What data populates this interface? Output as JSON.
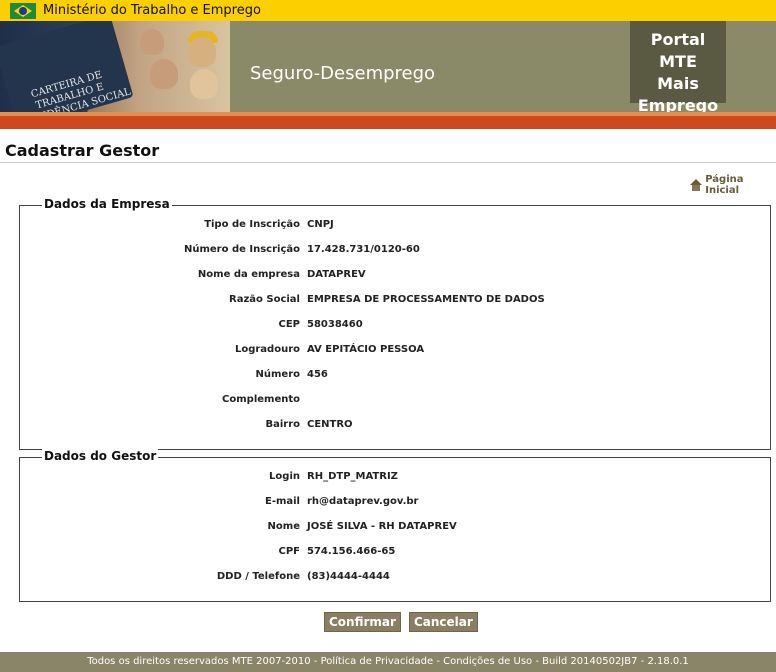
{
  "gov_bar": {
    "title": "Ministério do Trabalho e Emprego"
  },
  "banner": {
    "card_text": "CARTEIRA DE TRABALHO E PREVIDÊNCIA SOCIAL",
    "title": "Seguro-Desemprego",
    "portal_lines": [
      "Portal MTE",
      "Mais",
      "Emprego"
    ]
  },
  "page": {
    "title": "Cadastrar Gestor",
    "home_link": "Página Inicial"
  },
  "empresa": {
    "legend": "Dados da Empresa",
    "rows": [
      {
        "label": "Tipo de Inscrição",
        "value": "CNPJ"
      },
      {
        "label": "Número de Inscrição",
        "value": "17.428.731/0120-60"
      },
      {
        "label": "Nome da empresa",
        "value": "DATAPREV"
      },
      {
        "label": "Razão Social",
        "value": "EMPRESA DE PROCESSAMENTO DE DADOS"
      },
      {
        "label": "CEP",
        "value": "58038460"
      },
      {
        "label": "Logradouro",
        "value": "AV EPITÁCIO PESSOA"
      },
      {
        "label": "Número",
        "value": "456"
      },
      {
        "label": "Complemento",
        "value": ""
      },
      {
        "label": "Bairro",
        "value": "CENTRO"
      }
    ]
  },
  "gestor": {
    "legend": "Dados do Gestor",
    "rows": [
      {
        "label": "Login",
        "value": "RH_DTP_MATRIZ"
      },
      {
        "label": "E-mail",
        "value": "rh@dataprev.gov.br"
      },
      {
        "label": "Nome",
        "value": "JOSÉ SILVA - RH DATAPREV"
      },
      {
        "label": "CPF",
        "value": "574.156.466-65"
      },
      {
        "label": "DDD / Telefone",
        "value": "(83)4444-4444"
      }
    ]
  },
  "actions": {
    "confirm": "Confirmar",
    "cancel": "Cancelar"
  },
  "footer": {
    "text": "Todos os direitos reservados MTE 2007-2010 - Política de Privacidade - Condições de Uso - Build 20140502JB7 - 2.18.0.1"
  }
}
